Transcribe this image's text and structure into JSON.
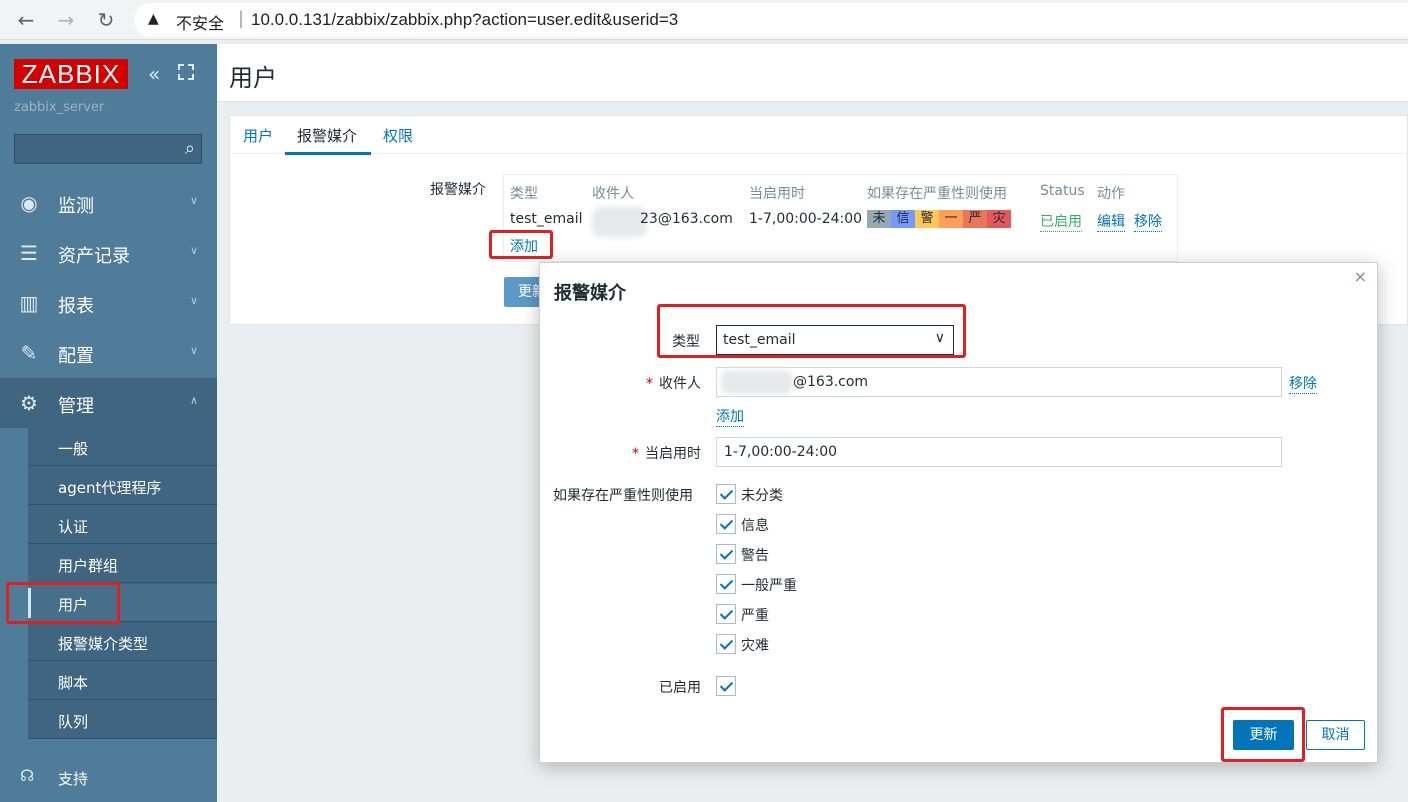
{
  "browser": {
    "back_icon": "←",
    "forward_icon": "→",
    "reload_icon": "↻",
    "warning_icon": "▲",
    "insecure_label": "不安全",
    "separator": "|",
    "url": "10.0.0.131/zabbix/zabbix.php?action=user.edit&userid=3"
  },
  "sidebar": {
    "logo": "ZABBIX",
    "server_name": "zabbix_server",
    "menu": [
      {
        "label": "监测",
        "icon": "eye-icon"
      },
      {
        "label": "资产记录",
        "icon": "list-icon"
      },
      {
        "label": "报表",
        "icon": "bar-chart-icon"
      },
      {
        "label": "配置",
        "icon": "wrench-icon"
      },
      {
        "label": "管理",
        "icon": "gear-icon"
      }
    ],
    "submenu": [
      "一般",
      "agent代理程序",
      "认证",
      "用户群组",
      "用户",
      "报警媒介类型",
      "脚本",
      "队列"
    ],
    "support_label": "支持"
  },
  "header": {
    "title": "用户"
  },
  "tabs": [
    {
      "label": "用户"
    },
    {
      "label": "报警媒介"
    },
    {
      "label": "权限"
    }
  ],
  "media": {
    "label": "报警媒介",
    "columns": [
      "类型",
      "收件人",
      "当启用时",
      "如果存在严重性则使用",
      "Status",
      "动作"
    ],
    "row": {
      "type": "test_email",
      "recipient": "23@163.com",
      "when_active": "1-7,00:00-24:00",
      "severity_letters": [
        "未",
        "信",
        "警",
        "一",
        "严",
        "灾"
      ],
      "severity_colors": [
        "#97aab3",
        "#7499ff",
        "#ffc859",
        "#ffa059",
        "#e97659",
        "#e45959"
      ],
      "status": "已启用",
      "edit": "编辑",
      "remove": "移除"
    },
    "add": "添加",
    "update_button": "更新"
  },
  "dialog": {
    "title": "报警媒介",
    "close": "×",
    "type_label": "类型",
    "type_value": "test_email",
    "send_to_label": "收件人",
    "send_to_value": "@163.com",
    "remove": "移除",
    "add": "添加",
    "when_active_label": "当启用时",
    "when_active_value": "1-7,00:00-24:00",
    "severity_label": "如果存在严重性则使用",
    "severities": [
      "未分类",
      "信息",
      "警告",
      "一般严重",
      "严重",
      "灾难"
    ],
    "enabled_label": "已启用",
    "update_button": "更新",
    "cancel_button": "取消"
  }
}
